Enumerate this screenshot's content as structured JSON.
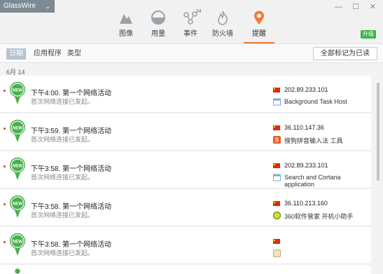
{
  "window": {
    "brand": "GlassWire",
    "minimize": "—",
    "maximize": "☐",
    "close": "✕"
  },
  "nav": {
    "tabs": [
      {
        "label": "图像"
      },
      {
        "label": "用量"
      },
      {
        "label": "事件",
        "badge": "34"
      },
      {
        "label": "防火墙"
      },
      {
        "label": "提醒"
      }
    ],
    "active": "提醒",
    "upgrade": "升级"
  },
  "subnav": {
    "tabs": [
      "日期",
      "应用程序",
      "类型"
    ],
    "active": "日期",
    "mark_all": "全部标记为已读"
  },
  "date_label": "6月 14",
  "alerts": [
    {
      "title": "下午4:00. 第一个网络活动",
      "subtitle": "首次网络连接已发起。",
      "ip": "202.89.233.101",
      "app": "Background Task Host",
      "app_icon": "window-icon"
    },
    {
      "title": "下午3:59. 第一个网络活动",
      "subtitle": "首次网络连接已发起。",
      "ip": "36.110.147.36",
      "app": "搜狗拼音输入法 工具",
      "app_icon": "sogou-icon"
    },
    {
      "title": "下午3:58. 第一个网络活动",
      "subtitle": "首次网络连接已发起。",
      "ip": "202.89.233.101",
      "app": "Search and Cortana application",
      "app_icon": "window-icon"
    },
    {
      "title": "下午3:58. 第一个网络活动",
      "subtitle": "首次网络连接已发起。",
      "ip": "36.110.213.160",
      "app": "360软件管家 开机小助手",
      "app_icon": "360-icon"
    },
    {
      "title": "下午3:58. 第一个网络活动",
      "subtitle": "首次网络连接已发起。",
      "ip": "",
      "app": "",
      "app_icon": "app-icon"
    }
  ],
  "pin_badge": "NEW",
  "colors": {
    "accent": "#f07b31",
    "pin_green": "#4caf50",
    "unread_dot": "#e23b3b",
    "upgrade": "#3cb54a"
  }
}
